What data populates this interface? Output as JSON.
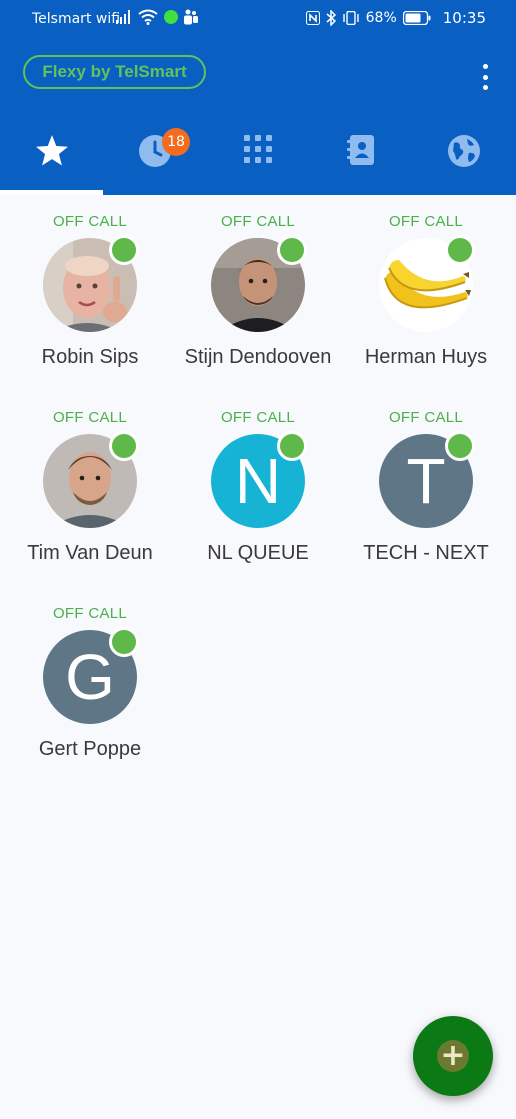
{
  "status_bar": {
    "carrier": "Telsmart wifi",
    "battery_percent": "68%",
    "time": "10:35",
    "icons": [
      "signal-icon",
      "wifi-icon",
      "green-dot-icon",
      "teams-icon",
      "nfc-icon",
      "bluetooth-icon",
      "vibrate-icon",
      "battery-icon"
    ]
  },
  "app": {
    "brand": "Flexy by TelSmart",
    "accent_color": "#0a5fc2",
    "brand_color": "#5fc35b"
  },
  "tabs": [
    {
      "icon": "star-icon",
      "name": "favorites",
      "active": true
    },
    {
      "icon": "clock-icon",
      "name": "recents",
      "badge": "18"
    },
    {
      "icon": "dialpad-icon",
      "name": "dialpad"
    },
    {
      "icon": "contacts-book-icon",
      "name": "contacts"
    },
    {
      "icon": "globe-icon",
      "name": "web"
    }
  ],
  "favorites": [
    {
      "status": "OFF CALL",
      "name": "Robin Sips",
      "avatar": "photo"
    },
    {
      "status": "OFF CALL",
      "name": "Stijn Dendooven",
      "avatar": "photo"
    },
    {
      "status": "OFF CALL",
      "name": "Herman Huys",
      "avatar": "banana-icon"
    },
    {
      "status": "OFF CALL",
      "name": "Tim Van Deun",
      "avatar": "photo"
    },
    {
      "status": "OFF CALL",
      "name": "NL QUEUE",
      "avatar_letter": "N",
      "avatar_color": "#16b3d4"
    },
    {
      "status": "OFF CALL",
      "name": "TECH - NEXT",
      "avatar_letter": "T",
      "avatar_color": "#5f7686"
    },
    {
      "status": "OFF CALL",
      "name": "Gert Poppe",
      "avatar_letter": "G",
      "avatar_color": "#5f7686"
    }
  ],
  "fab": {
    "icon": "plus-icon",
    "label": "+"
  }
}
